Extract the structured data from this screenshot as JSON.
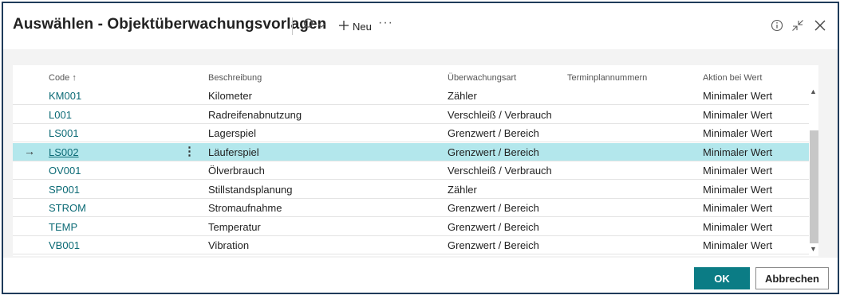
{
  "dialog": {
    "title": "Auswählen - Objektüberwachungsvorlagen",
    "new_label": "Neu",
    "more_label": "···"
  },
  "columns": {
    "code": "Code",
    "description": "Beschreibung",
    "monitoring_type": "Überwachungsart",
    "schedule_numbers": "Terminplannummern",
    "action": "Aktion bei Wert"
  },
  "rows": [
    {
      "code": "KM001",
      "description": "Kilometer",
      "monitoring_type": "Zähler",
      "schedule_numbers": "",
      "action": "Minimaler Wert"
    },
    {
      "code": "L001",
      "description": "Radreifenabnutzung",
      "monitoring_type": "Verschleiß / Verbrauch",
      "schedule_numbers": "",
      "action": "Minimaler Wert"
    },
    {
      "code": "LS001",
      "description": "Lagerspiel",
      "monitoring_type": "Grenzwert / Bereich",
      "schedule_numbers": "",
      "action": "Minimaler Wert"
    },
    {
      "code": "LS002",
      "description": "Läuferspiel",
      "monitoring_type": "Grenzwert / Bereich",
      "schedule_numbers": "",
      "action": "Minimaler Wert",
      "selected": true
    },
    {
      "code": "OV001",
      "description": "Ölverbrauch",
      "monitoring_type": "Verschleiß / Verbrauch",
      "schedule_numbers": "",
      "action": "Minimaler Wert"
    },
    {
      "code": "SP001",
      "description": "Stillstandsplanung",
      "monitoring_type": "Zähler",
      "schedule_numbers": "",
      "action": "Minimaler Wert"
    },
    {
      "code": "STROM",
      "description": "Stromaufnahme",
      "monitoring_type": "Grenzwert / Bereich",
      "schedule_numbers": "",
      "action": "Minimaler Wert"
    },
    {
      "code": "TEMP",
      "description": "Temperatur",
      "monitoring_type": "Grenzwert / Bereich",
      "schedule_numbers": "",
      "action": "Minimaler Wert"
    },
    {
      "code": "VB001",
      "description": "Vibration",
      "monitoring_type": "Grenzwert / Bereich",
      "schedule_numbers": "",
      "action": "Minimaler Wert"
    }
  ],
  "footer": {
    "ok_label": "OK",
    "cancel_label": "Abbrechen"
  },
  "colors": {
    "accent": "#0b7c85",
    "link": "#0b6a75",
    "selected_row": "#b3e7ec"
  },
  "icons": {
    "search": "search-icon",
    "new": "plus-icon",
    "info": "info-icon",
    "collapse": "collapse-icon",
    "close": "close-icon",
    "sort": "sort-ascending-icon"
  }
}
